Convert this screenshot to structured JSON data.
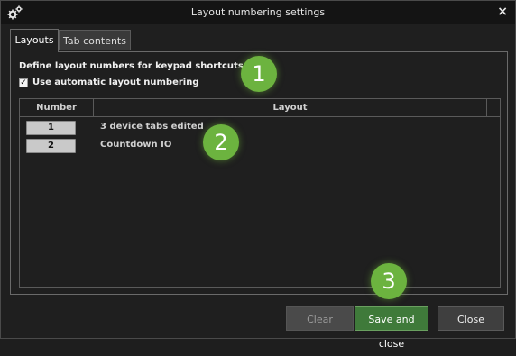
{
  "window": {
    "title": "Layout numbering settings",
    "icon": "gears-icon",
    "close_glyph": "×"
  },
  "tabs": [
    {
      "label": "Layouts",
      "active": true
    },
    {
      "label": "Tab contents",
      "active": false
    }
  ],
  "panel": {
    "description": "Define layout numbers for keypad shortcuts etc.",
    "auto_numbering": {
      "label": "Use automatic layout numbering",
      "checked": true,
      "check_glyph": "✓"
    }
  },
  "table": {
    "columns": [
      "Number",
      "Layout"
    ],
    "rows": [
      {
        "number": "1",
        "layout": "3 device tabs edited"
      },
      {
        "number": "2",
        "layout": "Countdown IO"
      }
    ]
  },
  "annotations": [
    "1",
    "2",
    "3"
  ],
  "buttons": {
    "clear": "Clear",
    "save": "Save and close",
    "close": "Close"
  },
  "colors": {
    "accent_green": "#6cb33f",
    "save_button": "#3f7a3a",
    "background": "#1f1f1f"
  }
}
